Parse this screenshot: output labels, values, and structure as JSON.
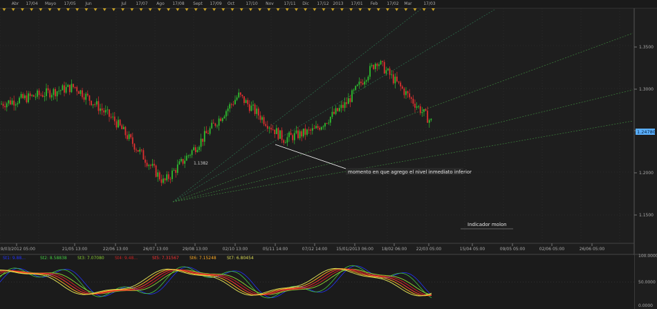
{
  "top_timeline": {
    "labels": [
      "Abr",
      "17/04",
      "Mayo",
      "17/05",
      "Jun",
      "Jul",
      "17/07",
      "Ago",
      "17/08",
      "Sept",
      "17/09",
      "Oct",
      "17/10",
      "Nov",
      "17/11",
      "Dic",
      "17/12",
      "2013",
      "17/01",
      "Feb",
      "17/02",
      "Mar",
      "17/03"
    ]
  },
  "main_chart": {
    "price_label": "1.24780",
    "price_axis": [
      "1.3500",
      "1.3000",
      "1.2500",
      "1.2000",
      "1.1500"
    ],
    "low_label": "1.1382",
    "time_axis": [
      "19/03/2012 05:00",
      "21/05 13:00",
      "22/06 13:00",
      "26/07 13:00",
      "29/08 13:00",
      "02/10 13:00",
      "05/11 14:00",
      "07/12 14:00",
      "15/01/2013 06:00",
      "18/02 06:00",
      "22/03 05:00",
      "15/04 05:00",
      "09/05 05:00",
      "02/06 05:00",
      "26/06 05:00"
    ]
  },
  "annotations": {
    "note1": "momento en que agrego el nivel inmediato inferior",
    "note2": "Indicador molon"
  },
  "indicator": {
    "legend": [
      "St1: 9.88...",
      "St2: 8.58838",
      "St3: 7.07080",
      "St4: 9.48...",
      "St5: 7.31567",
      "St6: 7.15248",
      "St7: 6.80454"
    ],
    "legend_colors": [
      "#2233ff",
      "#44cc44",
      "#88cc33",
      "#cc2222",
      "#ff3333",
      "#ffaa22",
      "#dddd55"
    ],
    "axis": [
      "100.0000",
      "50.0000",
      "0.0000"
    ]
  },
  "chart_data": {
    "type": "candlestick",
    "x": [
      "19/03/2012",
      "21/05",
      "22/06",
      "26/07",
      "29/08",
      "02/10",
      "05/11",
      "07/12",
      "15/01/2013",
      "18/02",
      "22/03"
    ],
    "y": [
      1.27,
      1.29,
      1.25,
      1.18,
      1.22,
      1.28,
      1.23,
      1.24,
      1.27,
      1.32,
      1.25
    ],
    "ylim": [
      1.11,
      1.38
    ]
  }
}
